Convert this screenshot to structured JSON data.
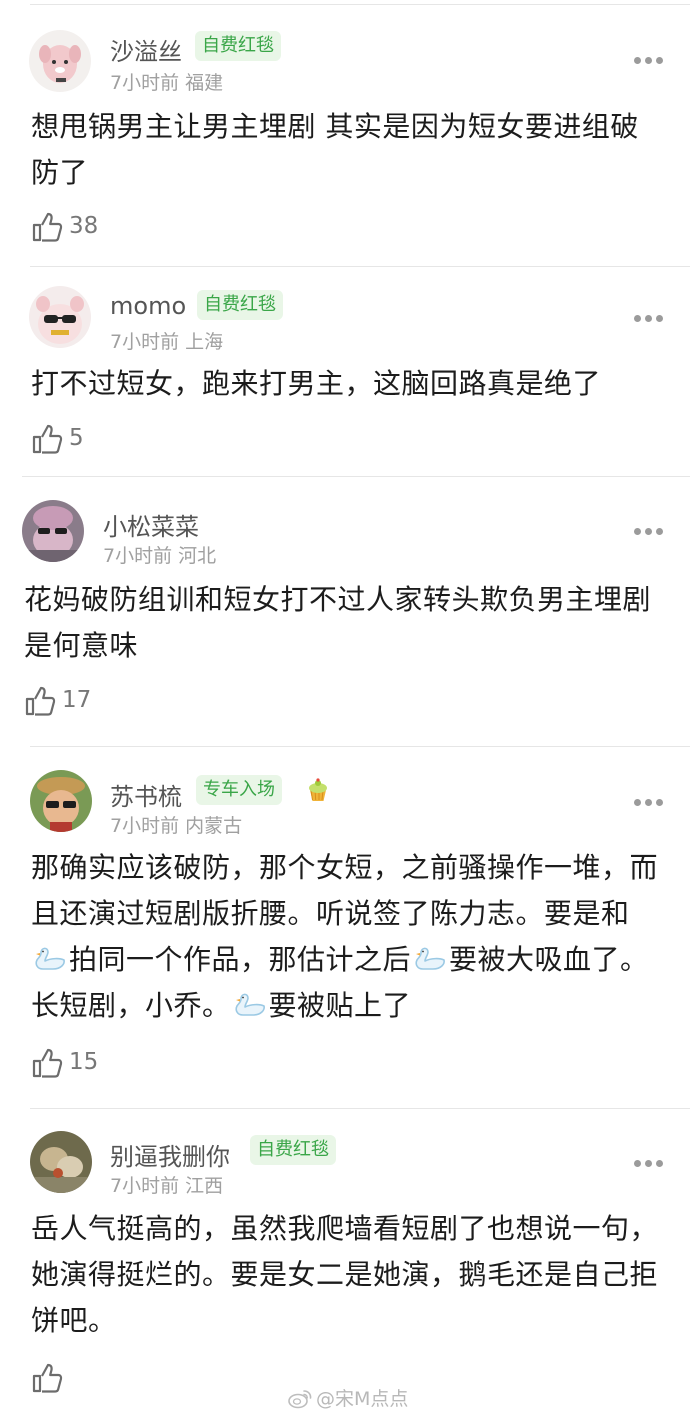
{
  "comments": [
    {
      "username": "沙溢丝",
      "tag": "自费红毯",
      "time": "7小时前",
      "location": "福建",
      "text": "想甩锅男主让男主埋剧 其实是因为短女要进组破防了",
      "likes": "38"
    },
    {
      "username": "momo",
      "tag": "自费红毯",
      "time": "7小时前",
      "location": "上海",
      "text": "打不过短女，跑来打男主，这脑回路真是绝了",
      "likes": "5"
    },
    {
      "username": "小松菜菜",
      "time": "7小时前",
      "location": "河北",
      "text": "花妈破防组训和短女打不过人家转头欺负男主埋剧是何意味",
      "likes": "17"
    },
    {
      "username": "苏书梳",
      "tag": "专车入场",
      "badge_icon": "cupcake-icon",
      "time": "7小时前",
      "location": "内蒙古",
      "text_parts": [
        "那确实应该破防，那个女短，之前骚操作一堆，而且还演过短剧版折腰。听说签了陈力志。要是和",
        "拍同一个作品，那估计之后",
        "要被大吸血了。长短剧，小乔。",
        "要被贴上了"
      ],
      "inline_icon": "swan-icon",
      "likes": "15"
    },
    {
      "username": "别逼我删你",
      "tag": "自费红毯",
      "time": "7小时前",
      "location": "江西",
      "text": "岳人气挺高的，虽然我爬墙看短剧了也想说一句，她演得挺烂的。要是女二是她演，鹅毛还是自己拒饼吧。",
      "likes": ""
    }
  ],
  "watermark": "@宋M点点",
  "colors": {
    "tag_bg": "#e9f6e7",
    "tag_text": "#3aa648",
    "meta": "#a0a0a0",
    "username": "#555555"
  }
}
